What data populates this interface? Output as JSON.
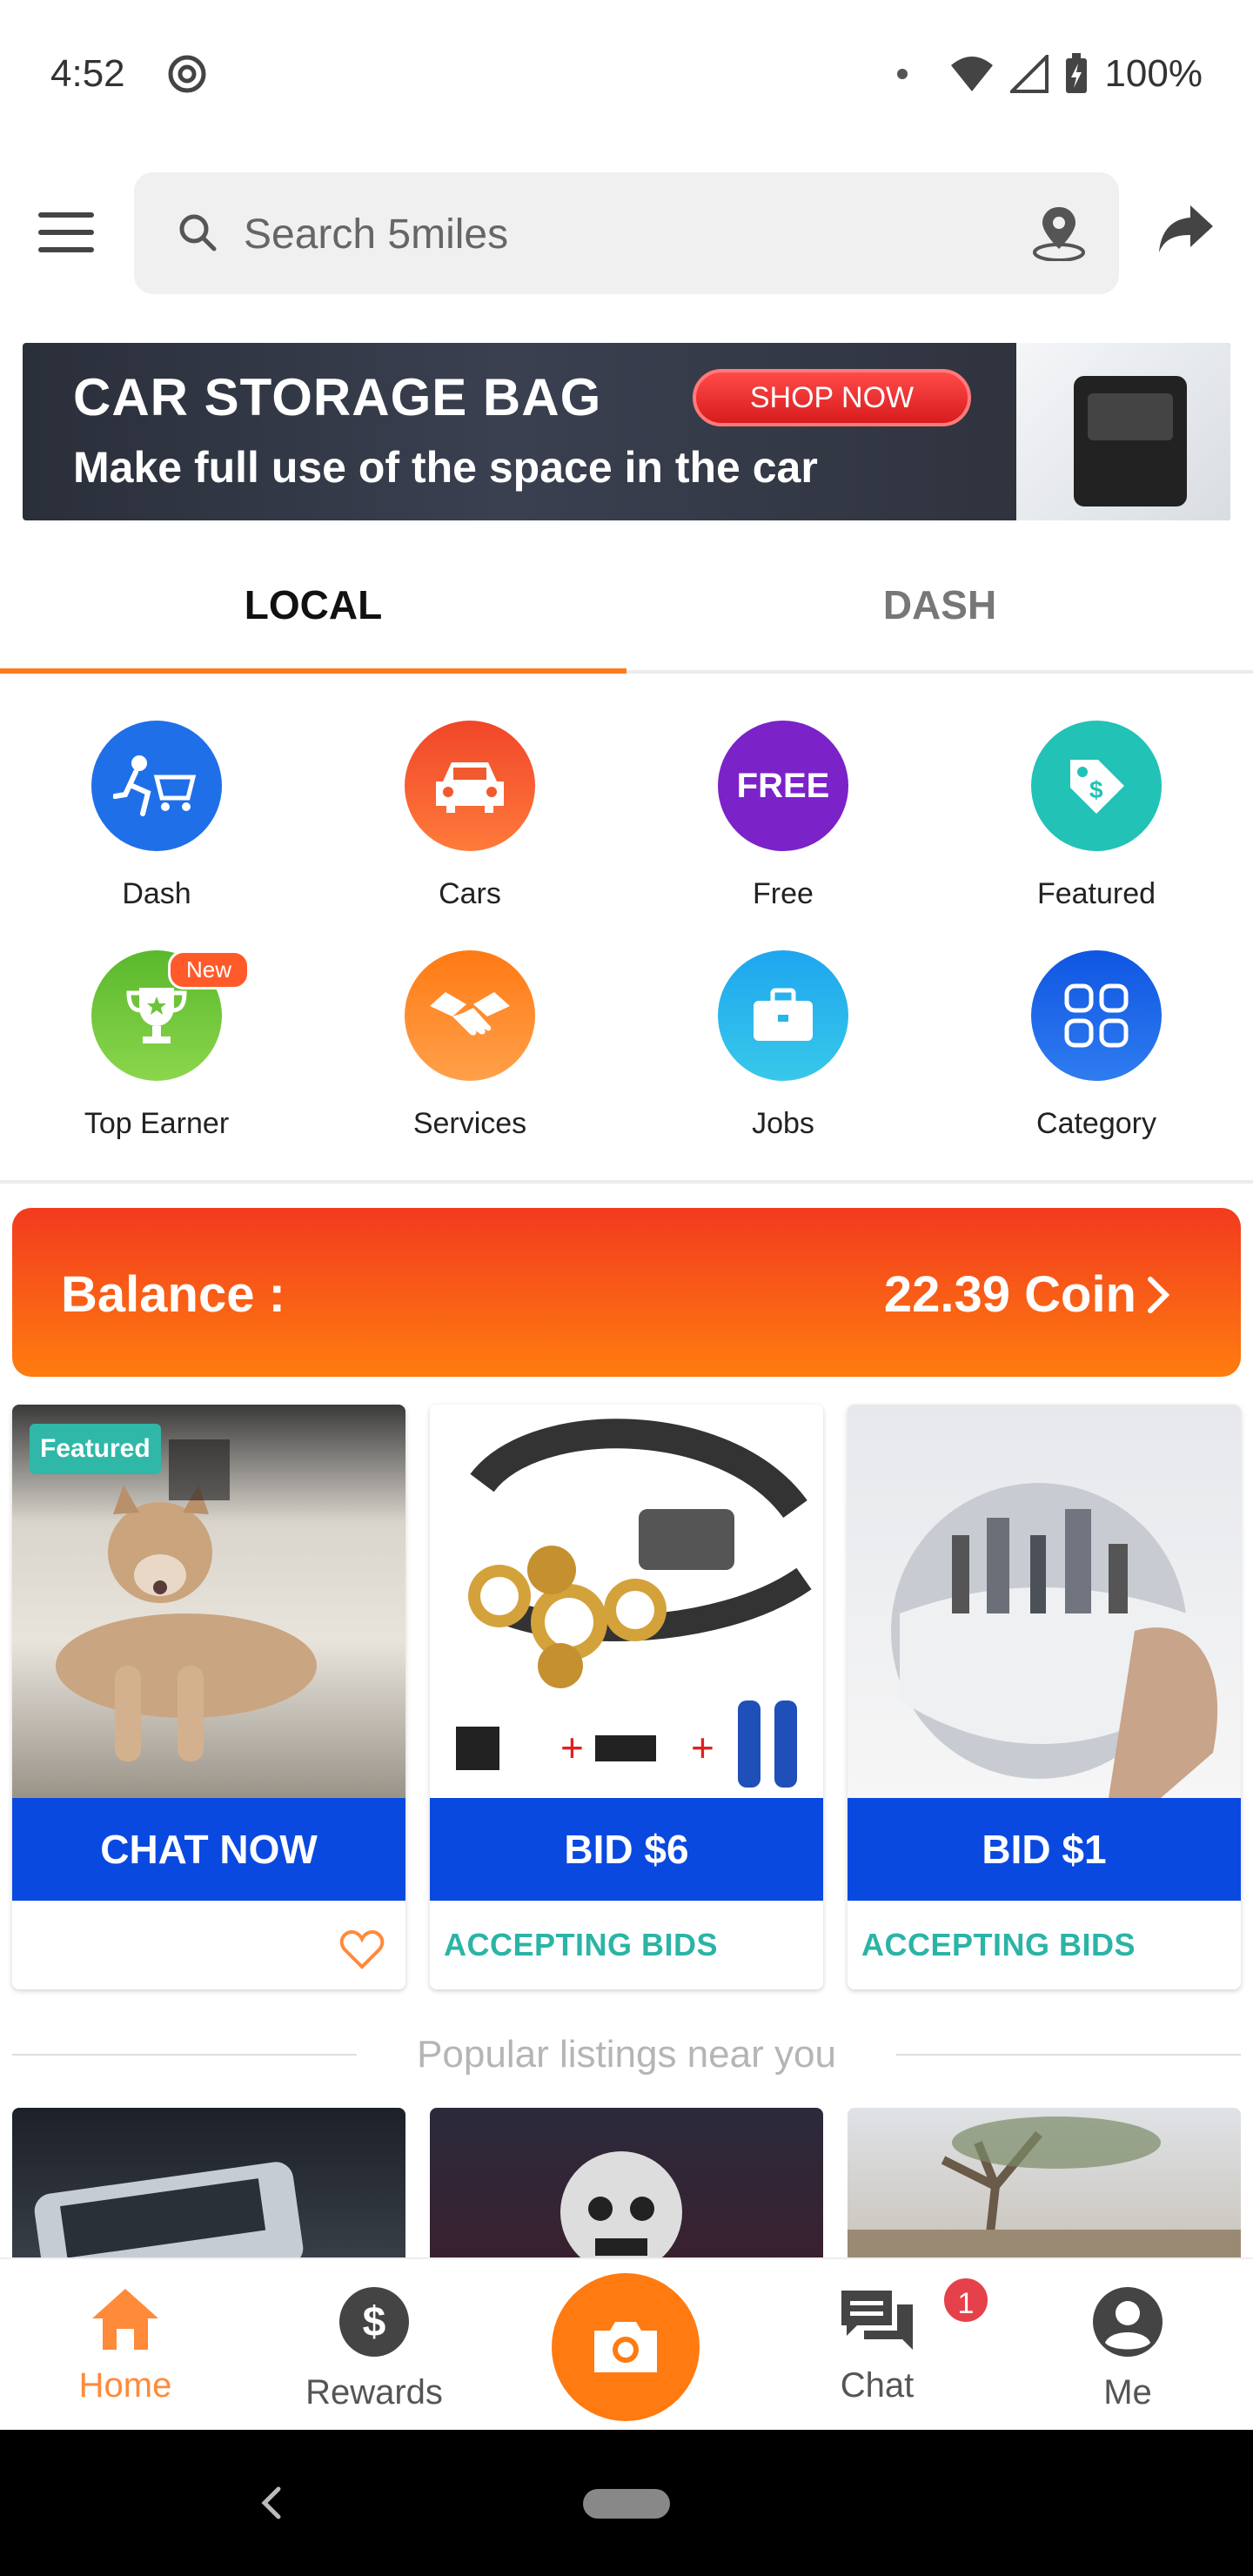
{
  "status_bar": {
    "time": "4:52",
    "battery": "100%"
  },
  "search": {
    "placeholder": "Search 5miles"
  },
  "banner": {
    "title": "CAR STORAGE BAG",
    "subtitle": "Make full use of the space in the car",
    "cta": "SHOP NOW"
  },
  "tabs": [
    {
      "label": "LOCAL",
      "active": true
    },
    {
      "label": "DASH",
      "active": false
    }
  ],
  "categories": [
    {
      "label": "Dash",
      "icon": "dash-icon",
      "color": "#1f6fe8"
    },
    {
      "label": "Cars",
      "icon": "car-icon",
      "color": "#f2542a"
    },
    {
      "label": "Free",
      "icon": "free-icon",
      "color": "#7b22c8",
      "icon_text": "FREE"
    },
    {
      "label": "Featured",
      "icon": "tag-icon",
      "color": "#22c2b6"
    },
    {
      "label": "Top Earner",
      "icon": "trophy-icon",
      "color": "#6cc43a",
      "badge": "New"
    },
    {
      "label": "Services",
      "icon": "handshake-icon",
      "color": "#ff8c26"
    },
    {
      "label": "Jobs",
      "icon": "briefcase-icon",
      "color": "#25b6ea"
    },
    {
      "label": "Category",
      "icon": "grid-icon",
      "color": "#1762e6"
    }
  ],
  "balance": {
    "label": "Balance :",
    "value": "22.39 Coin"
  },
  "products": [
    {
      "button": "CHAT NOW",
      "footer": "",
      "tag": "Featured",
      "image": "dog"
    },
    {
      "button": "BID $6",
      "footer": "ACCEPTING BIDS",
      "image": "headlamp"
    },
    {
      "button": "BID $1",
      "footer": "ACCEPTING BIDS",
      "image": "crystal-ball"
    }
  ],
  "popular": {
    "heading": "Popular listings near you"
  },
  "bottom_nav": [
    {
      "label": "Home",
      "icon": "home-icon",
      "active": true
    },
    {
      "label": "Rewards",
      "icon": "dollar-icon",
      "active": false
    },
    {
      "label": "",
      "icon": "camera-icon",
      "active": false
    },
    {
      "label": "Chat",
      "icon": "chat-icon",
      "active": false,
      "badge": "1"
    },
    {
      "label": "Me",
      "icon": "profile-icon",
      "active": false
    }
  ],
  "colors": {
    "accent": "#ff7a10",
    "bid_button": "#0a49e0",
    "accepting": "#2bb4a6"
  }
}
